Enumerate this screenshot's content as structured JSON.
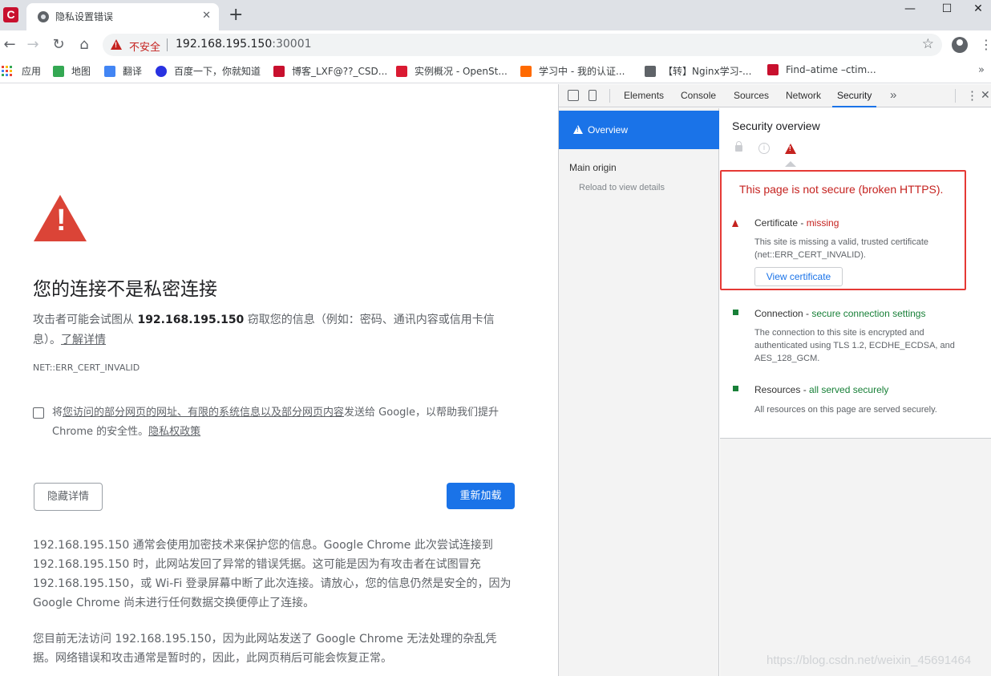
{
  "browser": {
    "tab_title": "隐私设置错误",
    "tab_close": "✕",
    "new_tab": "+",
    "window_buttons": {
      "minimize": "—",
      "maximize": "☐",
      "close": "✕"
    },
    "nav": {
      "back": "←",
      "forward": "→",
      "reload": "↻",
      "home": "⌂"
    },
    "omnibox": {
      "insecure_label": "不安全",
      "url_host": "192.168.195.150",
      "url_port": ":30001",
      "star": "☆"
    },
    "menu": "⋮",
    "bookmarks": [
      {
        "label": "应用",
        "icon": "apps-grid-icon"
      },
      {
        "label": "地图",
        "icon": "maps-icon",
        "color": "#34a853"
      },
      {
        "label": "翻译",
        "icon": "translate-icon",
        "color": "#4285f4"
      },
      {
        "label": "百度一下，你就知道",
        "icon": "baidu-icon",
        "color": "#2932e1"
      },
      {
        "label": "博客_LXF@??_CSD...",
        "icon": "csdn-icon",
        "color": "#c8102e"
      },
      {
        "label": "实例概况 - OpenSt...",
        "icon": "openstack-icon",
        "color": "#da1a32"
      },
      {
        "label": "学习中 - 我的认证...",
        "icon": "aliyun-icon",
        "color": "#ff6a00"
      },
      {
        "label": "【转】Nginx学习-...",
        "icon": "nginx-icon",
        "color": "#5f6368"
      },
      {
        "label": "Find–atime –ctim...",
        "icon": "csdn-icon",
        "color": "#c8102e"
      }
    ],
    "bookmarks_more": "»"
  },
  "page": {
    "heading": "您的连接不是私密连接",
    "desc_before": "攻击者可能会试图从 ",
    "desc_host": "192.168.195.150",
    "desc_after": " 窃取您的信息（例如：密码、通讯内容或信用卡信息）。",
    "learn_more": "了解详情",
    "error_code": "NET::ERR_CERT_INVALID",
    "optin_before": "将",
    "optin_link": "您访问的部分网页的网址、有限的系统信息以及部分网页内容",
    "optin_after": "发送给 Google，以帮助我们提升 Chrome 的安全性。",
    "privacy_link": "隐私权政策",
    "hide_details": "隐藏详情",
    "reload": "重新加载",
    "explanation_1": "192.168.195.150 通常会使用加密技术来保护您的信息。Google Chrome 此次尝试连接到 192.168.195.150 时，此网站发回了异常的错误凭据。这可能是因为有攻击者在试图冒充 192.168.195.150，或 Wi-Fi 登录屏幕中断了此次连接。请放心，您的信息仍然是安全的，因为 Google Chrome 尚未进行任何数据交换便停止了连接。",
    "explanation_2": "您目前无法访问 192.168.195.150，因为此网站发送了 Google Chrome 无法处理的杂乱凭据。网络错误和攻击通常是暂时的，因此，此网页稍后可能会恢复正常。"
  },
  "devtools": {
    "tabs": [
      "Elements",
      "Console",
      "Sources",
      "Network",
      "Security"
    ],
    "active_tab": "Security",
    "more": "»",
    "kebab": "⋮",
    "close": "✕",
    "sidebar": {
      "overview": "Overview",
      "main_origin": "Main origin",
      "reload_hint": "Reload to view details"
    },
    "security": {
      "title": "Security overview",
      "summary": "This page is not secure (broken HTTPS).",
      "certificate": {
        "label": "Certificate - ",
        "status": "missing",
        "desc": "This site is missing a valid, trusted certificate (net::ERR_CERT_INVALID).",
        "button": "View certificate"
      },
      "connection": {
        "label": "Connection - ",
        "status": "secure connection settings",
        "desc": "The connection to this site is encrypted and authenticated using TLS 1.2, ECDHE_ECDSA, and AES_128_GCM."
      },
      "resources": {
        "label": "Resources - ",
        "status": "all served securely",
        "desc": "All resources on this page are served securely."
      }
    }
  },
  "watermark": "https://blog.csdn.net/weixin_45691464"
}
